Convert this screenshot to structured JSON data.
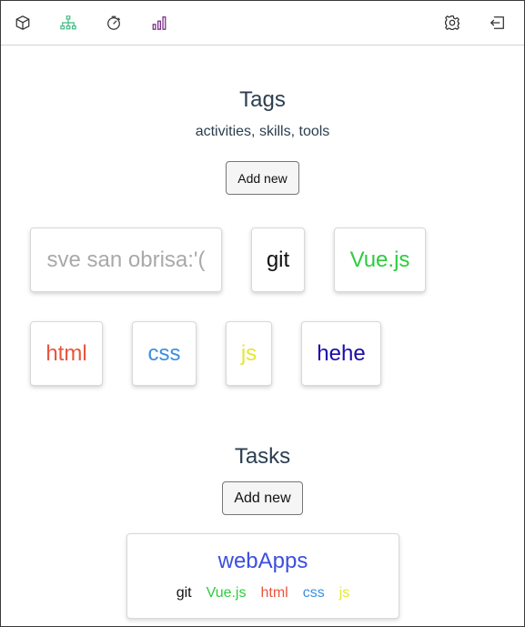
{
  "nav": {
    "left_icons": [
      "cube-icon",
      "sitemap-icon",
      "stopwatch-icon",
      "bar-chart-icon"
    ],
    "right_icons": [
      "gear-icon",
      "sign-out-icon"
    ],
    "colors": {
      "cube": "#333333",
      "sitemap": "#42b983",
      "stopwatch": "#333333",
      "bar_chart": "#7a2a8a",
      "gear": "#333333",
      "sign_out": "#333333"
    }
  },
  "tags_section": {
    "title": "Tags",
    "subtitle": "activities, skills, tools",
    "add_label": "Add new",
    "tags": [
      {
        "label": "sve san obrisa:'(",
        "color": "#a9a9a9"
      },
      {
        "label": "git",
        "color": "#111111"
      },
      {
        "label": "Vue.js",
        "color": "#2ecc40"
      },
      {
        "label": "html",
        "color": "#e8553d"
      },
      {
        "label": "css",
        "color": "#3b8fe0"
      },
      {
        "label": "js",
        "color": "#e6e634"
      },
      {
        "label": "hehe",
        "color": "#1a0ca8"
      }
    ]
  },
  "tasks_section": {
    "title": "Tasks",
    "add_label": "Add new",
    "tasks": [
      {
        "title": "webApps",
        "title_color": "#3b4fe0",
        "tags": [
          {
            "label": "git",
            "color": "#111111"
          },
          {
            "label": "Vue.js",
            "color": "#2ecc40"
          },
          {
            "label": "html",
            "color": "#e8553d"
          },
          {
            "label": "css",
            "color": "#3b8fe0"
          },
          {
            "label": "js",
            "color": "#e6e634"
          }
        ]
      }
    ]
  }
}
